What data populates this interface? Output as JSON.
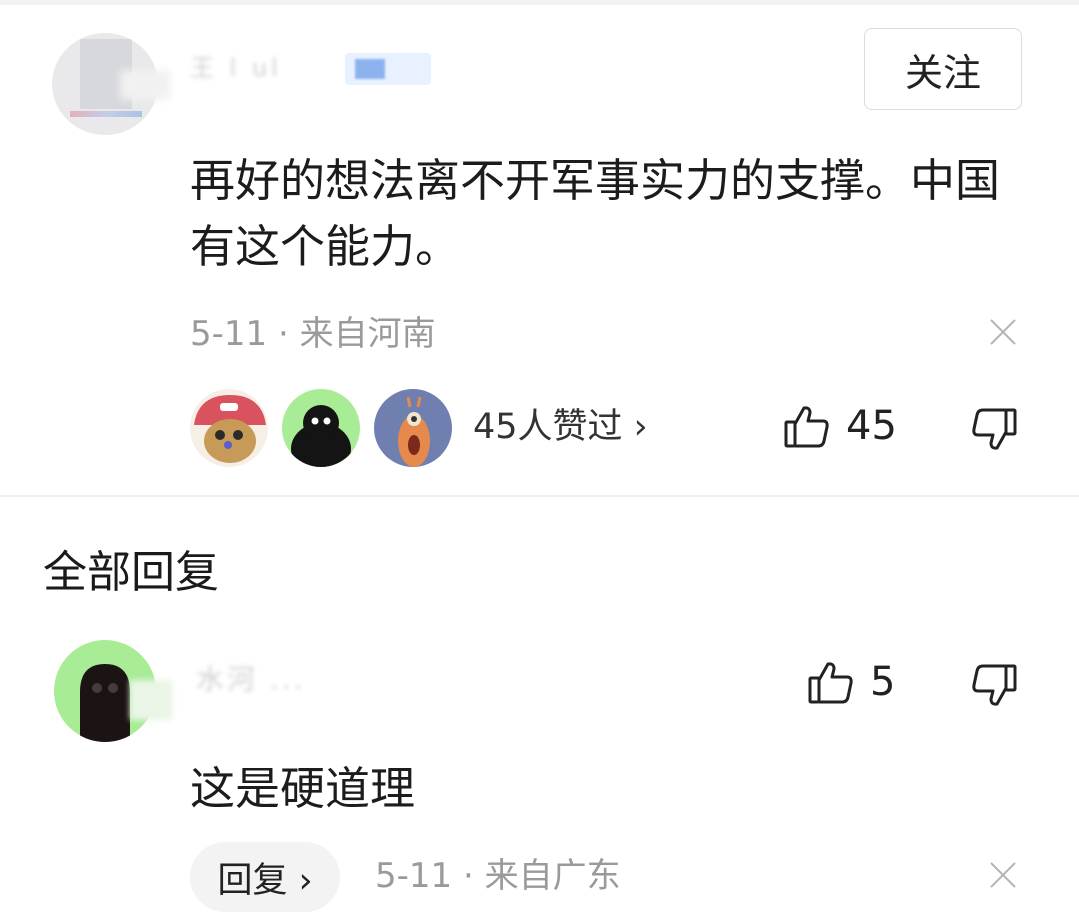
{
  "main_comment": {
    "username": "王 l  ul",
    "follow_label": "关注",
    "text": "再好的想法离不开军事实力的支撑。中国有这个能力。",
    "meta": "5-11 · 来自河南",
    "likers_text": "45人赞过 ›",
    "like_count": "45"
  },
  "replies_section": {
    "title": "全部回复"
  },
  "reply": {
    "username": "水河 ...",
    "like_count": "5",
    "text": "这是硬道理",
    "reply_label": "回复 ›",
    "meta": "5-11 · 来自广东"
  },
  "icons": {
    "like": "thumbs-up-icon",
    "dislike": "thumbs-down-icon",
    "close": "close-icon"
  },
  "colors": {
    "meta_gray": "#9a9a9a",
    "badge_blue": "#5d93e6",
    "avatar_green": "#a9ec96"
  }
}
